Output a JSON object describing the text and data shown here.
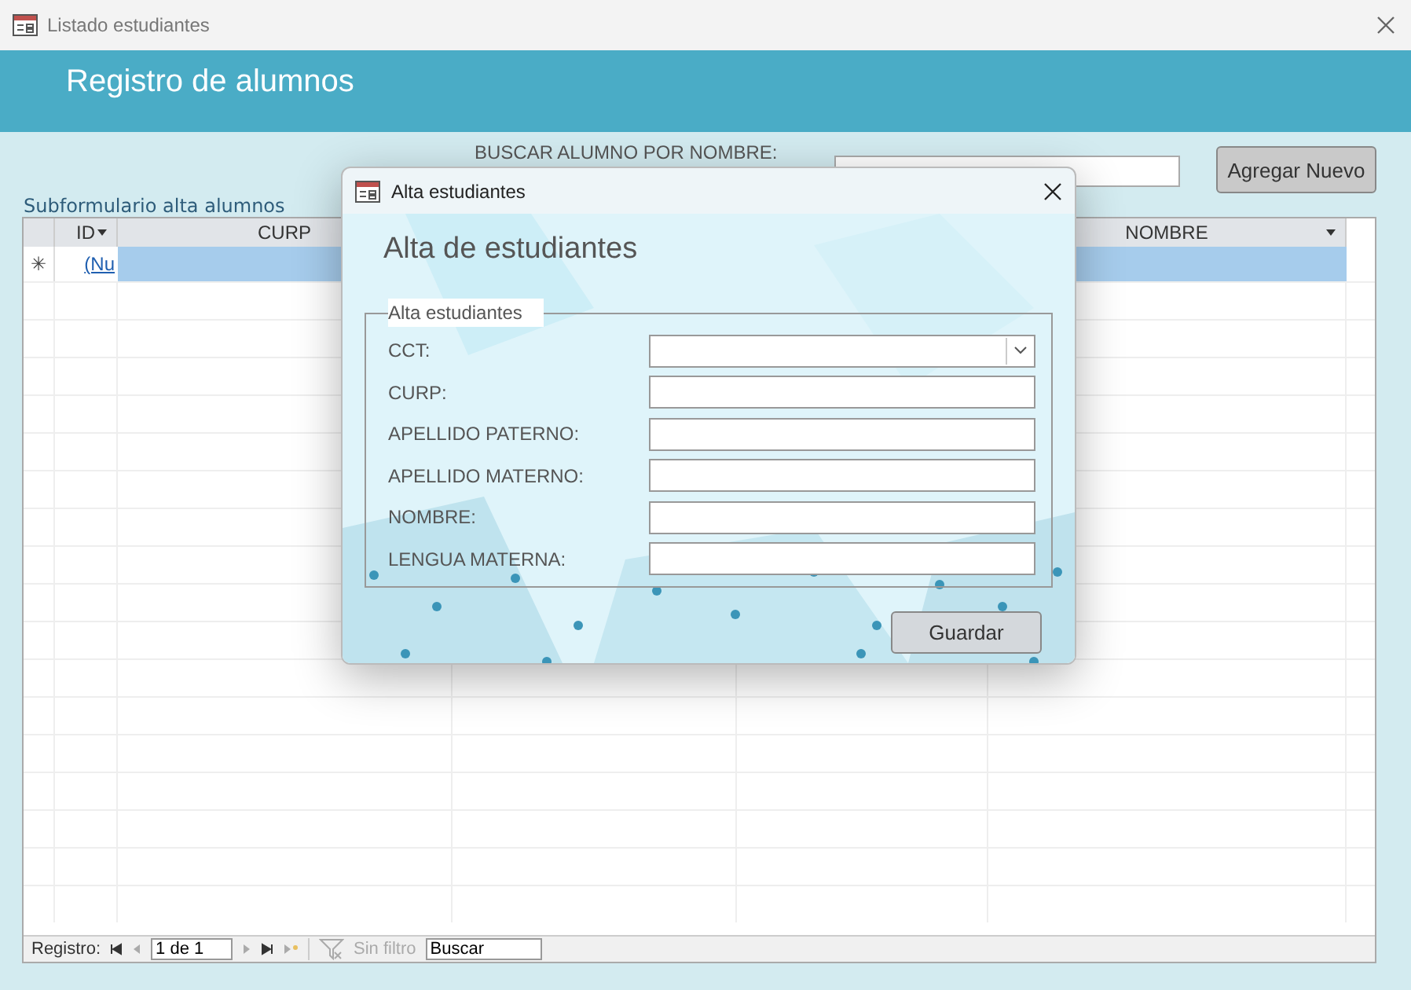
{
  "window": {
    "title": "Listado estudiantes"
  },
  "header": {
    "title": "Registro de alumnos"
  },
  "search": {
    "label": "BUSCAR ALUMNO POR NOMBRE:"
  },
  "add_button": "Agregar Nuevo",
  "subform": {
    "caption": "Subformulario alta alumnos",
    "columns": [
      {
        "label": "ID",
        "dropdown": true
      },
      {
        "label": "CURP"
      },
      {
        "label": "NOMBRE",
        "dropdown": true
      }
    ],
    "new_row": {
      "marker": "✳",
      "id": "(Nu",
      "selected": true
    }
  },
  "navigation": {
    "label": "Registro:",
    "position": "1 de 1",
    "filter": "Sin filtro",
    "search": "Buscar"
  },
  "dialog": {
    "title": "Alta estudiantes",
    "heading": "Alta de estudiantes",
    "group": "Alta estudiantes",
    "fields": [
      {
        "label": "CCT:",
        "kind": "combo"
      },
      {
        "label": "CURP:",
        "kind": "text"
      },
      {
        "label": "APELLIDO PATERNO:",
        "kind": "text"
      },
      {
        "label": "APELLIDO MATERNO:",
        "kind": "text"
      },
      {
        "label": "NOMBRE:",
        "kind": "text"
      },
      {
        "label": "LENGUA MATERNA:",
        "kind": "text"
      }
    ],
    "button": "Guardar"
  }
}
